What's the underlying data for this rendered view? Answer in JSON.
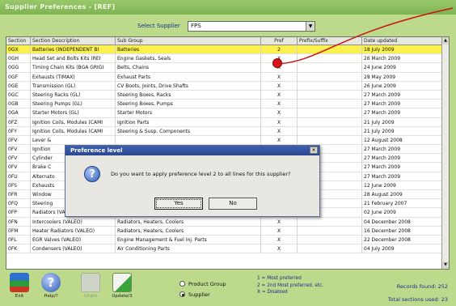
{
  "window": {
    "title": "Supplier Preferences - [REF]"
  },
  "supplier": {
    "label": "Select Supplier",
    "value": "FPS"
  },
  "columns": [
    "Section",
    "Section Description",
    "Sub Group",
    "Pref",
    "Prefix/Suffix",
    "Date updated"
  ],
  "rows": [
    {
      "code": "0GX",
      "desc": "Batteries (INDEPENDENT BI",
      "group": "Batteries",
      "pref": "2",
      "prefix": "",
      "date": "18 July 2009",
      "selected": true
    },
    {
      "code": "0GH",
      "desc": "Head Set and Bolts Kits (REI",
      "group": "Engine Gaskets, Seals",
      "pref": "X",
      "prefix": "",
      "date": "26 March 2009"
    },
    {
      "code": "0GG",
      "desc": "Timing Chain Kits (BGA GRIGI",
      "group": "Belts, Chains",
      "pref": "X",
      "prefix": "",
      "date": "24 June 2009"
    },
    {
      "code": "0GF",
      "desc": "Exhausts (TIMAX)",
      "group": "Exhaust Parts",
      "pref": "X",
      "prefix": "",
      "date": "28 May 2009"
    },
    {
      "code": "0GE",
      "desc": "Transmission (GL)",
      "group": "CV Boots, Joints, Drive Shafts",
      "pref": "X",
      "prefix": "",
      "date": "26 June 2009"
    },
    {
      "code": "0GC",
      "desc": "Steering Racks (GL)",
      "group": "Steering Boxes, Racks",
      "pref": "X",
      "prefix": "",
      "date": "27 March 2009"
    },
    {
      "code": "0GB",
      "desc": "Steering Pumps (GL)",
      "group": "Steering Boxes, Pumps",
      "pref": "X",
      "prefix": "",
      "date": "27 March 2009"
    },
    {
      "code": "0GA",
      "desc": "Starter Motors (GL)",
      "group": "Starter Motors",
      "pref": "X",
      "prefix": "",
      "date": "27 March 2009"
    },
    {
      "code": "0FZ",
      "desc": "Ignition Coils, Modules (CAMI",
      "group": "Ignition Parts",
      "pref": "X",
      "prefix": "",
      "date": "21 July 2009"
    },
    {
      "code": "0FY",
      "desc": "Ignition Coils, Modules (CAMI",
      "group": "Steering & Susp. Components",
      "pref": "X",
      "prefix": "",
      "date": "21 July 2009"
    },
    {
      "code": "0FV",
      "desc": "Lever &",
      "group": "",
      "pref": "X",
      "prefix": "",
      "date": "12 August 2008"
    },
    {
      "code": "0FV",
      "desc": "Ignition",
      "group": "",
      "pref": "",
      "prefix": "",
      "date": "27 March 2009"
    },
    {
      "code": "0FV",
      "desc": "Cylinder",
      "group": "",
      "pref": "",
      "prefix": "",
      "date": "27 March 2009"
    },
    {
      "code": "0FV",
      "desc": "Brake C",
      "group": "",
      "pref": "",
      "prefix": "",
      "date": "27 March 2009"
    },
    {
      "code": "0FU",
      "desc": "Alternato",
      "group": "",
      "pref": "",
      "prefix": "",
      "date": "27 March 2009"
    },
    {
      "code": "0FS",
      "desc": "Exhausts",
      "group": "",
      "pref": "",
      "prefix": "",
      "date": "12 June 2009"
    },
    {
      "code": "0FR",
      "desc": "Window",
      "group": "",
      "pref": "",
      "prefix": "",
      "date": "28 August 2009"
    },
    {
      "code": "0FQ",
      "desc": "Steering",
      "group": "",
      "pref": "",
      "prefix": "",
      "date": "21 February 2007"
    },
    {
      "code": "0FP",
      "desc": "Radiators (VALEO)",
      "group": "Radiators, Heaters, Coolers",
      "pref": "X",
      "prefix": "",
      "date": "02 June 2009"
    },
    {
      "code": "0FN",
      "desc": "Intercoolers (VALEO)",
      "group": "Radiators, Heaters, Coolers",
      "pref": "X",
      "prefix": "",
      "date": "04 December 2008"
    },
    {
      "code": "0FM",
      "desc": "Heater Radiators (VALEO)",
      "group": "Radiators, Heaters, Coolers",
      "pref": "X",
      "prefix": "",
      "date": "16 December 2008"
    },
    {
      "code": "0FL",
      "desc": "EGR Valves (VALEO)",
      "group": "Engine Management & Fuel Inj. Parts",
      "pref": "X",
      "prefix": "",
      "date": "22 December 2008"
    },
    {
      "code": "0FK",
      "desc": "Condensers (VALEO)",
      "group": "Air Conditioning Parts",
      "pref": "X",
      "prefix": "",
      "date": "04 July 2009"
    }
  ],
  "dialog": {
    "title": "Preference level",
    "message": "Do you want to apply preference level 2 to all lines for this supplier?",
    "yes": "Yes",
    "no": "No",
    "close": "×"
  },
  "toolbar": {
    "exit": "Exit",
    "help": "Help/?",
    "unpin": "Unpin",
    "update": "Update/3"
  },
  "view_mode": {
    "options": [
      "Product Group",
      "Supplier"
    ],
    "selected": "Supplier"
  },
  "legend": [
    "1 = Most preferred",
    "2 = 2nd Most preferred, etc.",
    "X = Disabled"
  ],
  "stats": {
    "records": "Records found: 252",
    "sections": "Total sections used: 23"
  },
  "colors": {
    "background": "#bcd98c",
    "selected_row": "#fbf04e",
    "annotation": "#d81818",
    "dialog_title": "#2b478f"
  }
}
